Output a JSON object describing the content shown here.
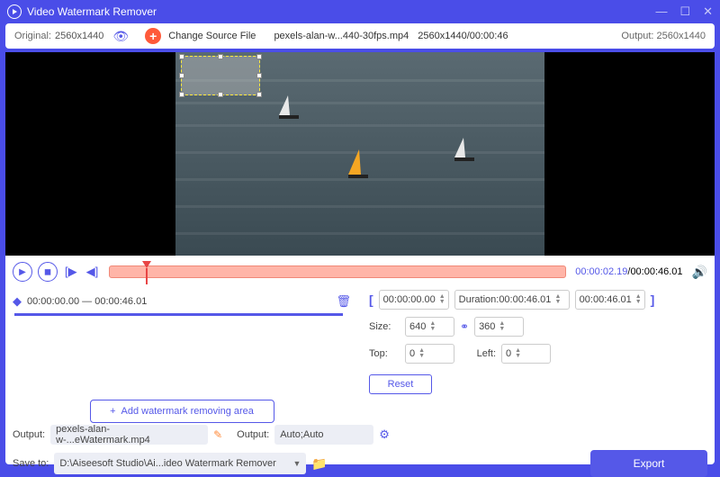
{
  "title": "Video Watermark Remover",
  "infobar": {
    "original_label": "Original:",
    "original_res": "2560x1440",
    "change_source": "Change Source File",
    "filename": "pexels-alan-w...440-30fps.mp4",
    "res_time": "2560x1440/00:00:46",
    "output_label": "Output:",
    "output_res": "2560x1440"
  },
  "playback": {
    "current": "00:00:02.19",
    "total": "00:00:46.01"
  },
  "segment": {
    "range": "00:00:00.00 — 00:00:46.01",
    "add_button": "Add watermark removing area"
  },
  "trim": {
    "start": "00:00:00.00",
    "duration_label": "Duration:",
    "duration": "00:00:46.01",
    "end": "00:00:46.01"
  },
  "size": {
    "label": "Size:",
    "w": "640",
    "h": "360"
  },
  "position": {
    "top_label": "Top:",
    "top": "0",
    "left_label": "Left:",
    "left": "0"
  },
  "reset": "Reset",
  "output": {
    "label": "Output:",
    "filename": "pexels-alan-w-...eWatermark.mp4",
    "format_label": "Output:",
    "format": "Auto;Auto"
  },
  "save": {
    "label": "Save to:",
    "path": "D:\\Aiseesoft Studio\\Ai...ideo Watermark Remover"
  },
  "export": "Export"
}
